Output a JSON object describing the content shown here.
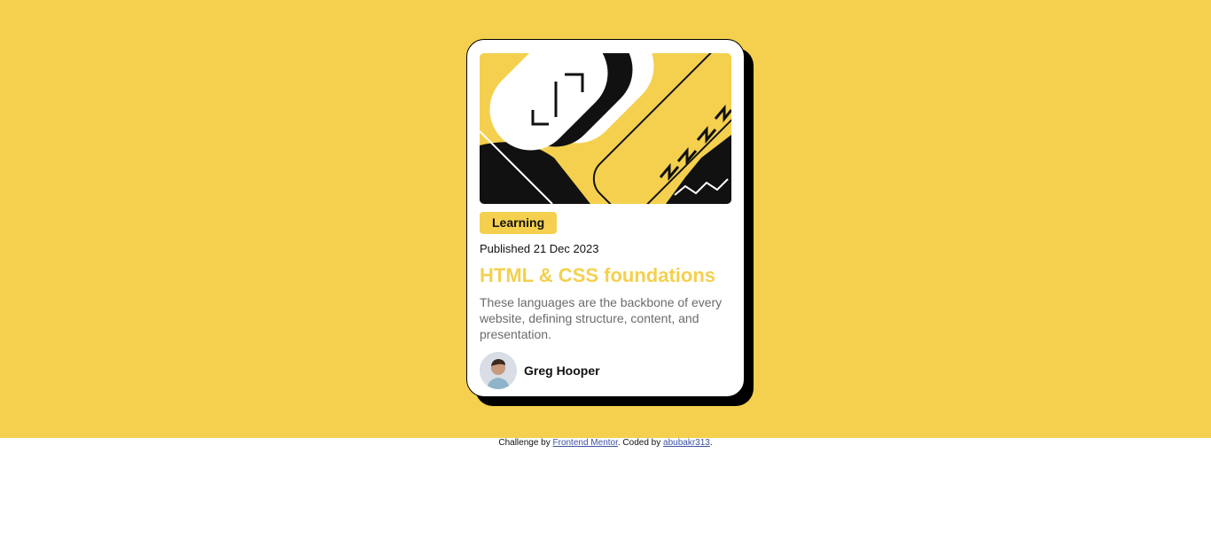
{
  "colors": {
    "background": "#f4d04e",
    "accent": "#f4d04e",
    "card": "#ffffff",
    "shadow": "#000000",
    "description_text": "#6b6b6b",
    "link": "#3e52a3"
  },
  "card": {
    "hero_illustration": "abstract-code-illustration",
    "tag": "Learning",
    "published": "Published 21 Dec 2023",
    "title": "HTML & CSS foundations",
    "description": "These languages are the backbone of every website, defining structure, content, and presentation.",
    "author": {
      "avatar_icon": "person-avatar",
      "name": "Greg Hooper"
    }
  },
  "attribution": {
    "prefix": "Challenge by ",
    "challenge_link": "Frontend Mentor",
    "middle": ". Coded by ",
    "author_link": "abubakr313",
    "suffix": "."
  }
}
